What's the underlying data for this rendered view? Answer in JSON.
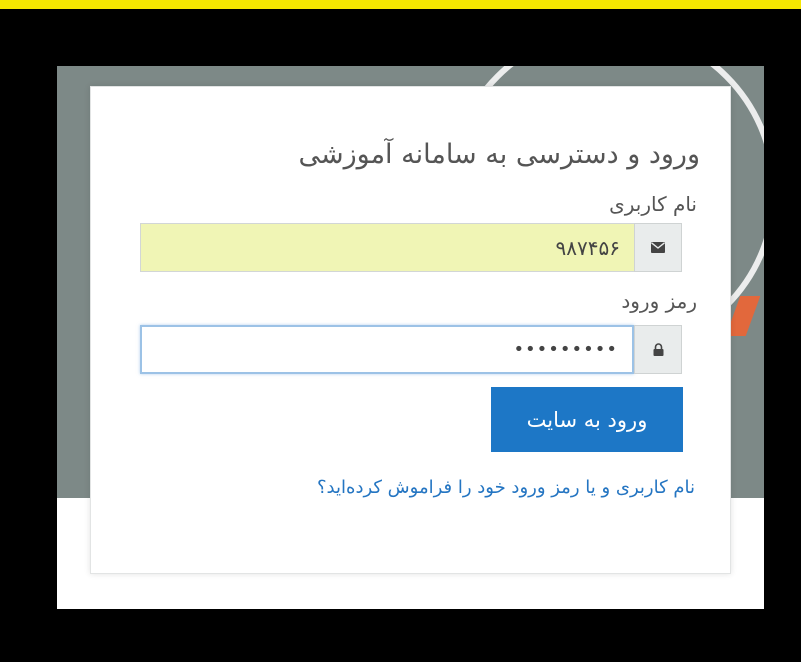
{
  "form": {
    "title": "ورود و دسترسی به سامانه آموزشی",
    "username_label": "نام کاربری",
    "username_value": "۹۸۷۴۵۶",
    "password_label": "رمز ورود",
    "password_value": "•••••••••",
    "submit_label": "ورود به سایت",
    "forgot_link": "نام کاربری و یا رمز ورود خود را فراموش کرده‌اید؟"
  },
  "icons": {
    "username_addon": "envelope-icon",
    "password_addon": "lock-icon"
  },
  "colors": {
    "frame_strip": "#f6e700",
    "button": "#1d77c6",
    "link": "#2475c2",
    "autofill": "#f0f5b5",
    "focus_border": "#9cc2e6"
  }
}
